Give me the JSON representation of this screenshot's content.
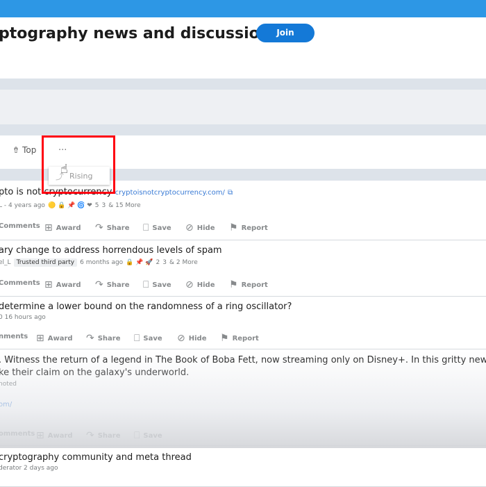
{
  "header": {
    "title": "ptography news and discussions",
    "join_label": "Join"
  },
  "sort": {
    "top_label": "Top",
    "more_label": "···",
    "dropdown_option": "Rising"
  },
  "posts": [
    {
      "title": "pto is not cryptocurrency",
      "link": "cryptoisnotcryptocurrency.com/",
      "meta_author": "L - 4 years ago",
      "meta_awards": "5",
      "meta_awards2": "3",
      "meta_more": "& 15 More",
      "comments_label": "Comments",
      "award_label": "Award",
      "share_label": "Share",
      "save_label": "Save",
      "hide_label": "Hide",
      "report_label": "Report"
    },
    {
      "title": "ary change to address horrendous levels of spam",
      "meta_author": "el_L",
      "meta_flair": "Trusted third party",
      "meta_time": "6 months ago",
      "meta_awards": "2",
      "meta_awards2": "3",
      "meta_more": "& 2 More",
      "comments_label": "Comments",
      "award_label": "Award",
      "share_label": "Share",
      "save_label": "Save",
      "hide_label": "Hide",
      "report_label": "Report"
    },
    {
      "title": "determine a lower bound on the randomness of a ring oscillator?",
      "meta_time": "0 16 hours ago",
      "comments_label": "nments",
      "award_label": "Award",
      "share_label": "Share",
      "save_label": "Save",
      "hide_label": "Hide",
      "report_label": "Report"
    },
    {
      "title_line1": ". Witness the return of a legend in The Book of Boba Fett, now streaming only on Disney+. In this gritty new Star",
      "title_line2": "ke their claim on the galaxy's underworld.",
      "meta_promoted": "noted",
      "link": "om/",
      "comments_label": "omments",
      "award_label": "Award",
      "share_label": "Share",
      "save_label": "Save"
    },
    {
      "title": "cryptography community and meta thread",
      "meta_time": "derator 2 days ago"
    }
  ]
}
